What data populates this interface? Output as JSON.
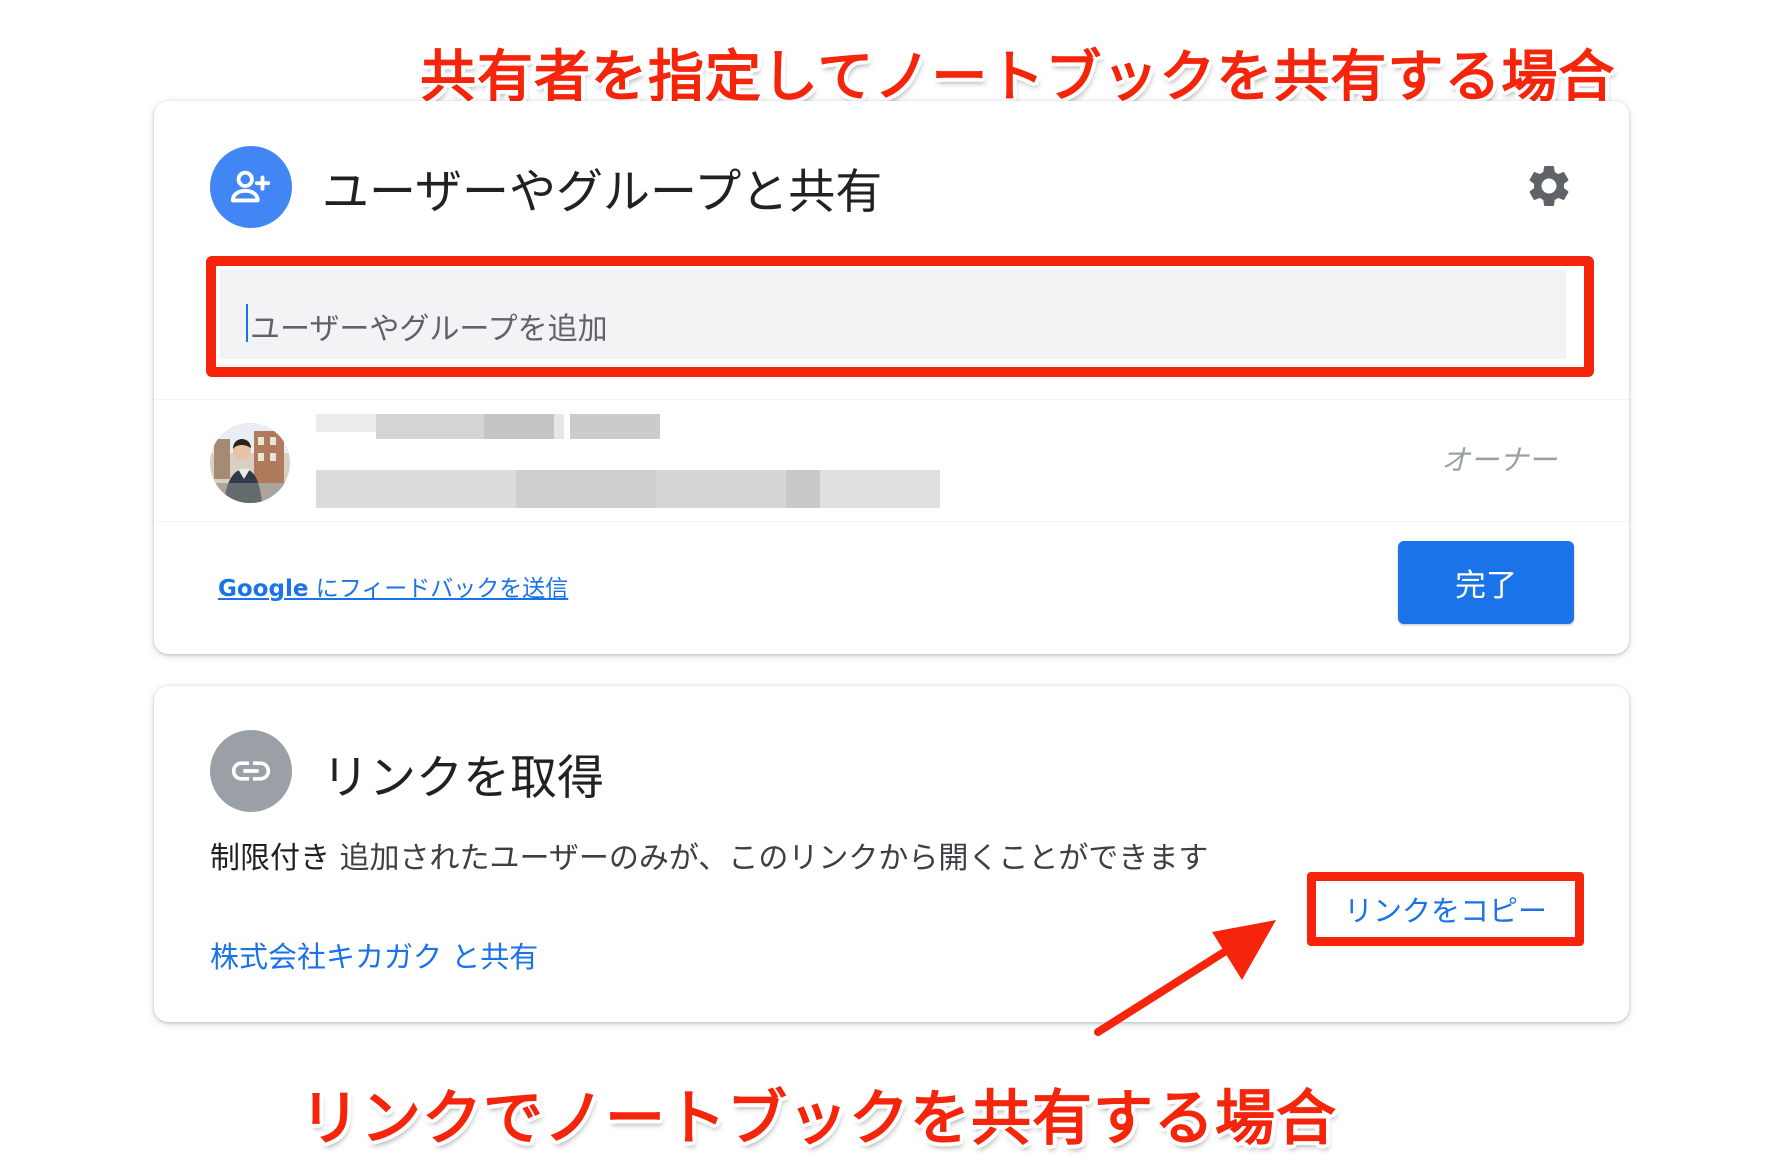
{
  "annotations": {
    "top": "共有者を指定してノートブックを共有する場合",
    "bottom": "リンクでノートブックを共有する場合"
  },
  "share_dialog": {
    "title": "ユーザーやグループと共有",
    "input_placeholder": "ユーザーやグループを追加",
    "member": {
      "role": "オーナー"
    },
    "feedback_link": {
      "brand": "Google",
      "text": " にフィードバックを送信"
    },
    "done_button": "完了"
  },
  "link_dialog": {
    "title": "リンクを取得",
    "restriction_label": "制限付き",
    "restriction_text": " 追加されたユーザーのみが、このリンクから開くことができます",
    "shared_with": "株式会社キカガク と共有",
    "copy_link": "リンクをコピー"
  },
  "colors": {
    "accent": "#1a73e8",
    "annotation_red": "#f4250a",
    "share_icon_bg": "#4285f4",
    "link_icon_bg": "#9aa0a6"
  },
  "icons": {
    "share": "person-add-icon",
    "settings": "gear-icon",
    "link": "link-icon"
  }
}
